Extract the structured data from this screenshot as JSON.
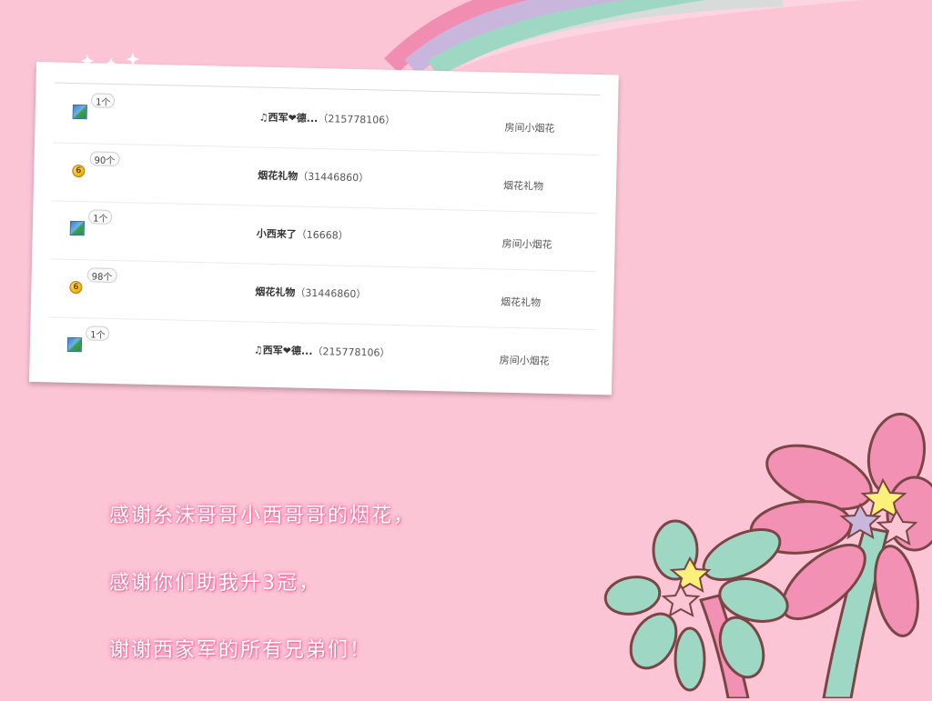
{
  "gift_list": {
    "rows": [
      {
        "icon": "picture-gift-icon",
        "count": "1个",
        "sender_name": "♫西军❤德...",
        "sender_id": "（215778106）",
        "gift": "房间小烟花"
      },
      {
        "icon": "coin-6-icon",
        "count": "90个",
        "sender_name": "烟花礼物",
        "sender_id": "（31446860）",
        "gift": "烟花礼物"
      },
      {
        "icon": "picture-gift-icon",
        "count": "1个",
        "sender_name": "小西来了",
        "sender_id": "（16668）",
        "gift": "房间小烟花"
      },
      {
        "icon": "coin-6-icon",
        "count": "98个",
        "sender_name": "烟花礼物",
        "sender_id": "（31446860）",
        "gift": "烟花礼物"
      },
      {
        "icon": "picture-gift-icon",
        "count": "1个",
        "sender_name": "♫西军❤德...",
        "sender_id": "（215778106）",
        "gift": "房间小烟花"
      }
    ]
  },
  "coin_label": "6",
  "message": {
    "line1": "感谢糸沫哥哥小西哥哥的烟花，",
    "line2": "感谢你们助我升3冠，",
    "line3": "谢谢西家军的所有兄弟们！"
  },
  "colors": {
    "background": "#fcc5d6",
    "rainbow": [
      "#f28db2",
      "#c9b6dc",
      "#9ed8c5"
    ],
    "flower_pink": "#f291b3",
    "flower_mint": "#9ed8c5",
    "star_yellow": "#fbf07a",
    "star_lavender": "#c9b6dc"
  }
}
